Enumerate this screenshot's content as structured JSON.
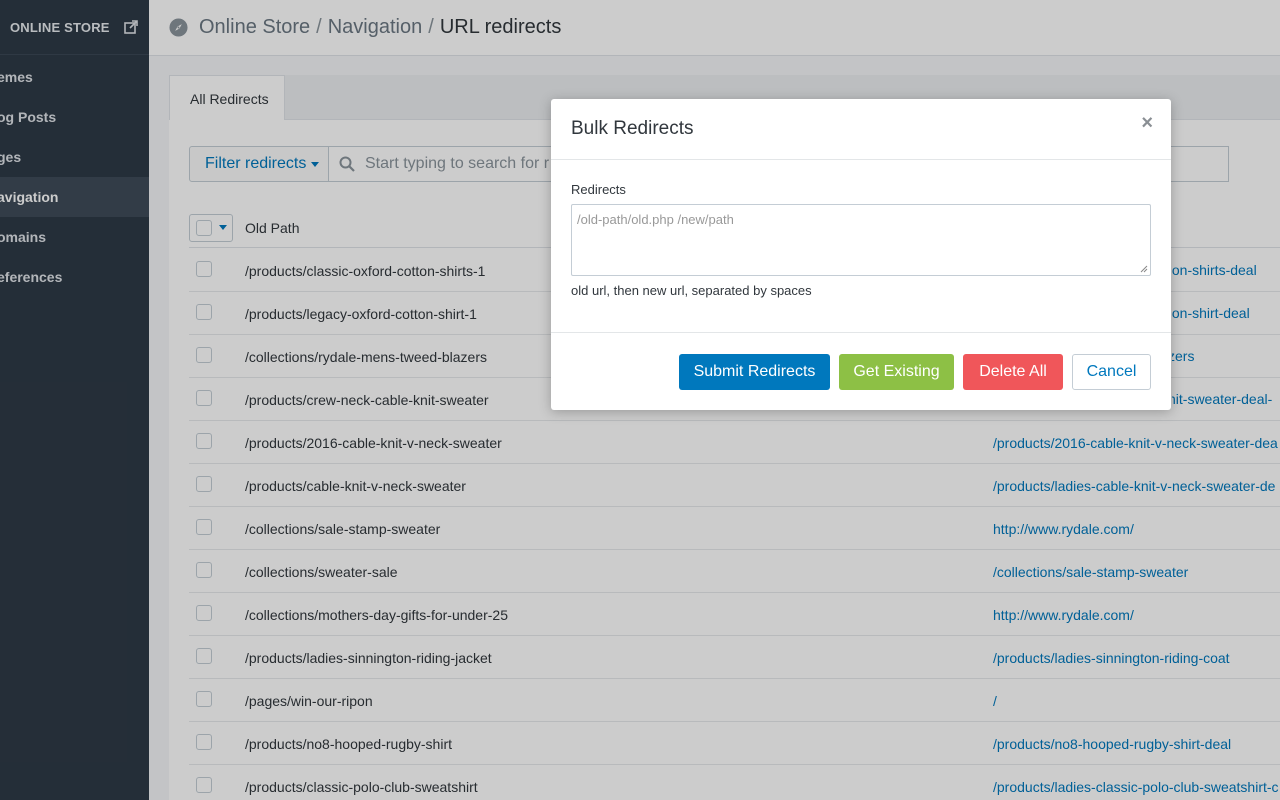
{
  "sidebar": {
    "title": "ONLINE STORE",
    "items": [
      {
        "label": "emes"
      },
      {
        "label": "og Posts"
      },
      {
        "label": "ges"
      },
      {
        "label": "avigation"
      },
      {
        "label": "omains"
      },
      {
        "label": "eferences"
      }
    ]
  },
  "header": {
    "crumb1": "Online Store",
    "crumb2": "Navigation",
    "current": "URL redirects",
    "sep": "/"
  },
  "tabs": {
    "all_redirects": "All Redirects"
  },
  "filter": {
    "label": "Filter redirects",
    "search_placeholder": "Start typing to search for r"
  },
  "table": {
    "old_path_header": "Old Path",
    "rows": [
      {
        "old": "/products/classic-oxford-cotton-shirts-1",
        "new": ""
      },
      {
        "old": "/products/legacy-oxford-cotton-shirt-1",
        "new": ""
      },
      {
        "old": "/collections/rydale-mens-tweed-blazers",
        "new": ""
      },
      {
        "old": "/products/crew-neck-cable-knit-sweater",
        "new": ""
      },
      {
        "old": "/products/2016-cable-knit-v-neck-sweater",
        "new": "/products/2016-cable-knit-v-neck-sweater-dea"
      },
      {
        "old": "/products/cable-knit-v-neck-sweater",
        "new": "/products/ladies-cable-knit-v-neck-sweater-de"
      },
      {
        "old": "/collections/sale-stamp-sweater",
        "new": "http://www.rydale.com/"
      },
      {
        "old": "/collections/sweater-sale",
        "new": "/collections/sale-stamp-sweater"
      },
      {
        "old": "/collections/mothers-day-gifts-for-under-25",
        "new": "http://www.rydale.com/"
      },
      {
        "old": "/products/ladies-sinnington-riding-jacket",
        "new": "/products/ladies-sinnington-riding-coat"
      },
      {
        "old": "/pages/win-our-ripon",
        "new": "/"
      },
      {
        "old": "/products/no8-hooped-rugby-shirt",
        "new": "/products/no8-hooped-rugby-shirt-deal"
      },
      {
        "old": "/products/classic-polo-club-sweatshirt",
        "new": "/products/ladies-classic-polo-club-sweatshirt-c"
      }
    ],
    "peek_new": [
      "ton-shirts-deal",
      "ton-shirt-deal",
      "zers",
      "nit-sweater-deal-"
    ]
  },
  "modal": {
    "title": "Bulk Redirects",
    "close": "×",
    "field_label": "Redirects",
    "placeholder": "/old-path/old.php /new/path",
    "help": "old url, then new url, separated by spaces",
    "buttons": {
      "submit": "Submit Redirects",
      "existing": "Get Existing",
      "delete": "Delete All",
      "cancel": "Cancel"
    }
  },
  "colors": {
    "primary": "#0078bd",
    "success": "#8dc045",
    "danger": "#f0565a",
    "sidebar": "#2e3a46"
  }
}
